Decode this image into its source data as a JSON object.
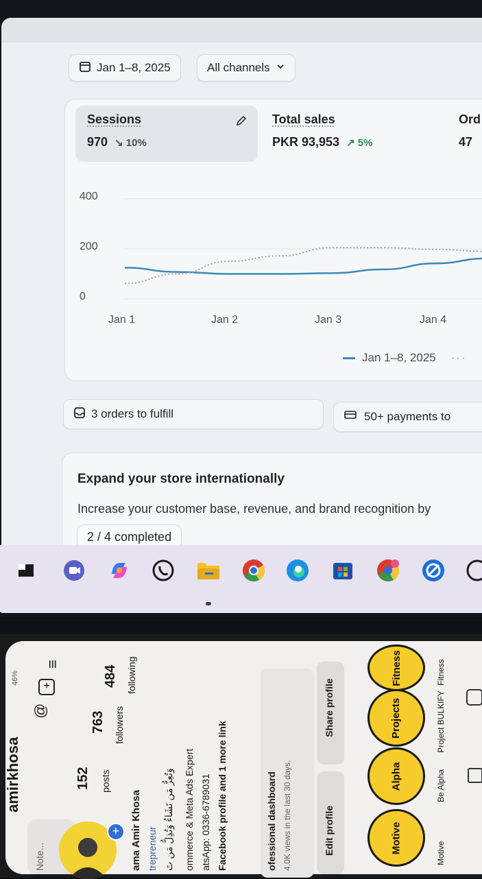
{
  "filters": {
    "date_range": "Jan 1–8, 2025",
    "channels": "All channels"
  },
  "metrics": {
    "sessions": {
      "label": "Sessions",
      "value": "970",
      "change": "↘ 10%"
    },
    "total_sales": {
      "label": "Total sales",
      "value": "PKR 93,953",
      "change": "↗ 5%"
    },
    "orders": {
      "label": "Ord",
      "value": "47"
    }
  },
  "chart_data": {
    "type": "line",
    "x": [
      "Jan 1",
      "Jan 2",
      "Jan 3",
      "Jan 4"
    ],
    "y_ticks": [
      "400",
      "200",
      "0"
    ],
    "ylim": [
      0,
      400
    ],
    "legend": "Jan 1–8, 2025",
    "series": [
      {
        "name": "Jan 1–8, 2025",
        "style": "solid",
        "color": "#3f88b8",
        "points": [
          [
            0,
            125
          ],
          [
            0.5,
            108
          ],
          [
            1,
            100
          ],
          [
            1.5,
            100
          ],
          [
            2,
            103
          ],
          [
            2.5,
            118
          ],
          [
            3,
            142
          ],
          [
            3.5,
            162
          ]
        ]
      },
      {
        "style": "dotted",
        "color": "#9aa3ad",
        "points": [
          [
            0,
            62
          ],
          [
            0.5,
            100
          ],
          [
            1,
            150
          ],
          [
            1.5,
            172
          ],
          [
            2,
            205
          ],
          [
            2.5,
            205
          ],
          [
            3,
            198
          ],
          [
            3.5,
            190
          ]
        ]
      }
    ]
  },
  "tasks": {
    "orders_to_fulfill": "3 orders to fulfill",
    "payments": "50+ payments to"
  },
  "expand": {
    "title": "Expand your store internationally",
    "description": "Increase your customer base, revenue, and brand recognition by",
    "progress": "2 / 4 completed"
  },
  "taskbar": {
    "icons": [
      "task-view-icon",
      "teams-icon",
      "copilot-icon",
      "whatsapp-icon",
      "file-explorer-icon",
      "chrome-icon",
      "edge-icon",
      "store-icon",
      "chrome-profile-icon",
      "chrome-remote-icon",
      "whatsapp-icon"
    ]
  },
  "phone": {
    "username": "amirkhosa",
    "battery": "46%",
    "note": "Note...",
    "stats": {
      "posts": "152",
      "posts_label": "posts",
      "followers": "763",
      "followers_label": "followers",
      "following": "484",
      "following_label": "following"
    },
    "bio": {
      "name": "ama Amir Khosa",
      "category": "trepreneur",
      "arabic": "وَتُعِزُّ مَن تَشَاءُ وَتُذِلُّ مَن تَ",
      "line1": "ommerce & Meta Ads Expert",
      "line2": "atsApp: 0336-6789031",
      "link": "Facebook profile and 1 more link"
    },
    "dashboard": {
      "title": "ofessional dashboard",
      "subtitle": "4.0K views in the last 30 days."
    },
    "buttons": {
      "edit": "Edit profile",
      "share": "Share profile"
    },
    "highlights": [
      {
        "label": "Motive",
        "caption": "Motive"
      },
      {
        "label": "Alpha",
        "caption": "Be Alpha"
      },
      {
        "label": "Projects",
        "caption": "Project BULKIFY"
      },
      {
        "label": "Fitness",
        "caption": "Fitness"
      }
    ]
  }
}
